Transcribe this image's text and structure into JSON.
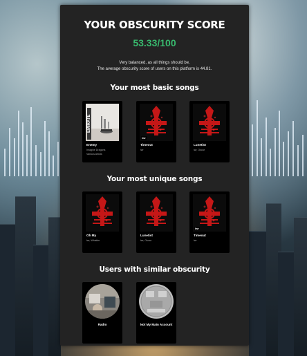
{
  "header": {
    "title": "YOUR OBSCURITY SCORE",
    "score": "53.33/100",
    "description_line1": "Very balanced, as all things should be.",
    "description_line2": "The average obscurity score of users on this platform is 44.81."
  },
  "basic_songs": {
    "heading": "Your most basic songs",
    "items": [
      {
        "name": "Enemy",
        "artist": "Imagine Dragons",
        "artist_line2": "Various Artists",
        "art": "enemy-cover"
      },
      {
        "name": "Timeout",
        "artist": "lwr",
        "art": "cross-cover",
        "badge": "lwr"
      },
      {
        "name": "Lunetist",
        "artist": "lwr, Oscar",
        "art": "cross-cover"
      }
    ]
  },
  "unique_songs": {
    "heading": "Your most unique songs",
    "items": [
      {
        "name": "Oh My",
        "artist": "lwr, Whistler",
        "art": "cross-cover"
      },
      {
        "name": "Lunetist",
        "artist": "lwr, Oscar",
        "art": "cross-cover"
      },
      {
        "name": "Timeout",
        "artist": "lwr",
        "art": "cross-cover",
        "badge": "lwr"
      }
    ]
  },
  "similar_users": {
    "heading": "Users with similar obscurity",
    "items": [
      {
        "name": "Radio",
        "avatar": "photo-avatar"
      },
      {
        "name": "Not My Main Account",
        "avatar": "grey-avatar"
      }
    ]
  },
  "colors": {
    "panel": "#232323",
    "score_green": "#38b86d",
    "card_bg": "#000000",
    "art_red": "#d01818"
  }
}
